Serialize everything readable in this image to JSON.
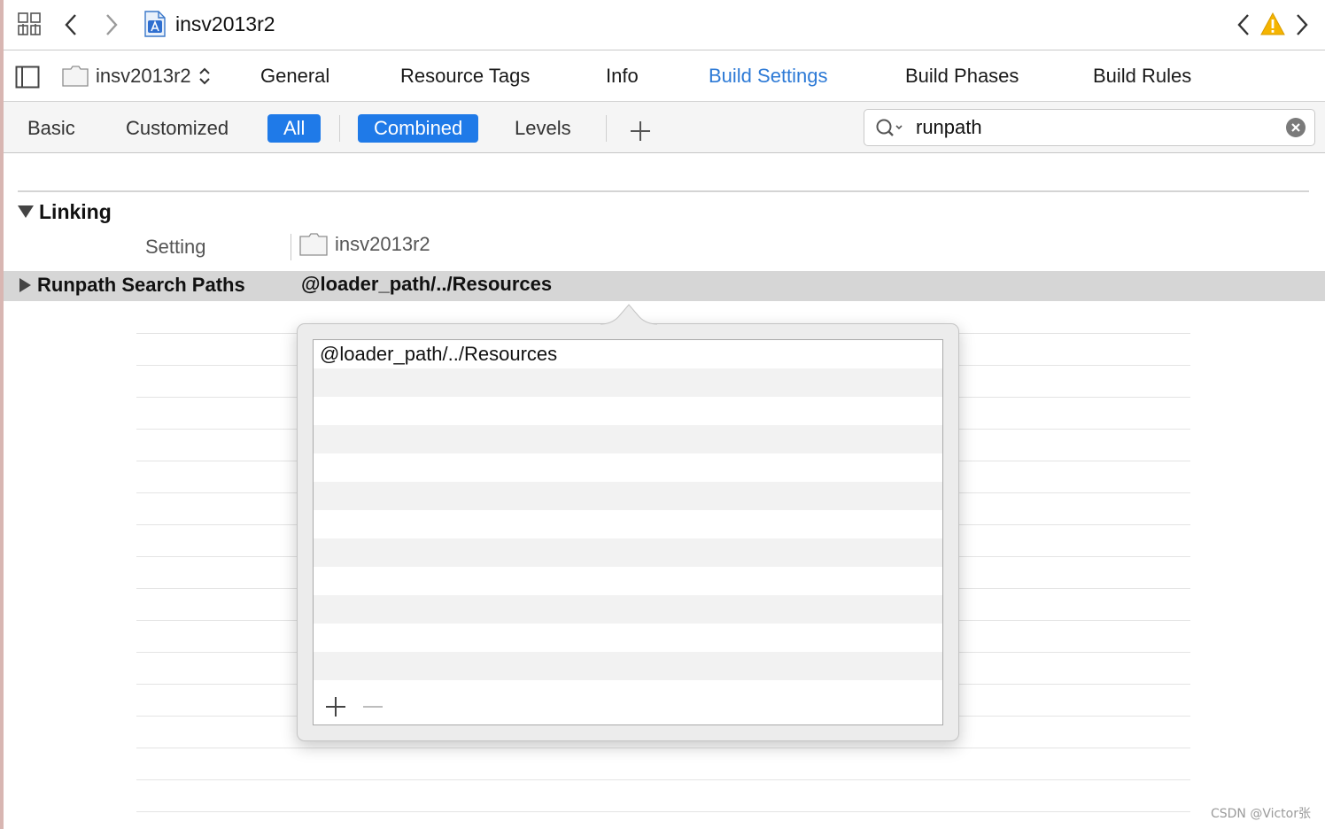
{
  "jumpbar": {
    "project_name": "insv2013r2"
  },
  "tabs": {
    "target_name": "insv2013r2",
    "items": [
      {
        "label": "General",
        "active": false
      },
      {
        "label": "Resource Tags",
        "active": false
      },
      {
        "label": "Info",
        "active": false
      },
      {
        "label": "Build Settings",
        "active": true
      },
      {
        "label": "Build Phases",
        "active": false
      },
      {
        "label": "Build Rules",
        "active": false
      }
    ]
  },
  "filter": {
    "basic": "Basic",
    "customized": "Customized",
    "all": "All",
    "combined": "Combined",
    "levels": "Levels",
    "search_value": "runpath"
  },
  "section": {
    "title": "Linking",
    "col_setting": "Setting",
    "col_target": "insv2013r2"
  },
  "setting_row": {
    "name": "Runpath Search Paths",
    "value": "@loader_path/../Resources"
  },
  "popover": {
    "entries": [
      "@loader_path/../Resources"
    ]
  },
  "watermark": "CSDN @Victor张",
  "colors": {
    "accent": "#2d7ad6",
    "selected_segment": "#1f7ae8",
    "warning": "#f5b400",
    "selected_row": "#d6d6d6"
  }
}
